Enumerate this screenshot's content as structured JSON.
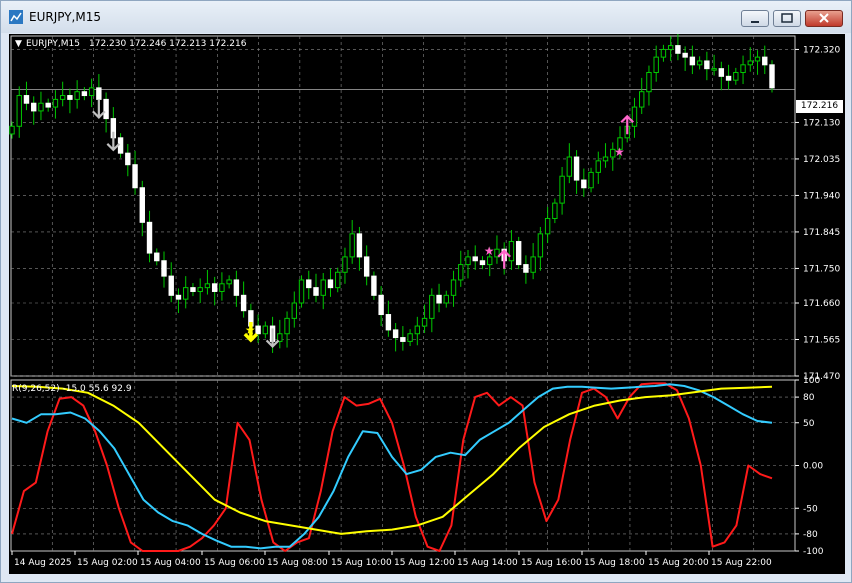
{
  "window": {
    "title": "EURJPY,M15"
  },
  "chart_data": [
    {
      "type": "candlestick",
      "symbol_header": "EURJPY,M15",
      "ohlc_header": "172.230 172.246 172.213 172.216",
      "current_price": "172.216",
      "y_ticks": [
        "172.320",
        "172.216",
        "172.130",
        "172.035",
        "171.940",
        "171.845",
        "171.750",
        "171.660",
        "171.565",
        "171.470"
      ],
      "ylim": [
        171.47,
        172.355
      ],
      "x_ticks": [
        "14 Aug 2025",
        "15 Aug 02:00",
        "15 Aug 04:00",
        "15 Aug 06:00",
        "15 Aug 08:00",
        "15 Aug 10:00",
        "15 Aug 12:00",
        "15 Aug 14:00",
        "15 Aug 16:00",
        "15 Aug 18:00",
        "15 Aug 20:00",
        "15 Aug 22:00"
      ],
      "close": [
        172.12,
        172.2,
        172.18,
        172.16,
        172.18,
        172.17,
        172.19,
        172.2,
        172.19,
        172.21,
        172.2,
        172.22,
        172.19,
        172.14,
        172.09,
        172.05,
        172.02,
        171.96,
        171.87,
        171.79,
        171.77,
        171.73,
        171.68,
        171.67,
        171.7,
        171.69,
        171.7,
        171.71,
        171.69,
        171.71,
        171.72,
        171.68,
        171.64,
        171.6,
        171.58,
        171.6,
        171.56,
        171.58,
        171.62,
        171.66,
        171.72,
        171.7,
        171.68,
        171.72,
        171.7,
        171.74,
        171.78,
        171.84,
        171.78,
        171.73,
        171.68,
        171.63,
        171.59,
        171.57,
        171.56,
        171.58,
        171.6,
        171.62,
        171.68,
        171.66,
        171.68,
        171.72,
        171.76,
        171.78,
        171.77,
        171.76,
        171.78,
        171.8,
        171.77,
        171.82,
        171.76,
        171.74,
        171.78,
        171.84,
        171.88,
        171.92,
        171.99,
        172.04,
        171.98,
        171.96,
        172.0,
        172.03,
        172.04,
        172.06,
        172.09,
        172.12,
        172.17,
        172.21,
        172.26,
        172.3,
        172.32,
        172.33,
        172.31,
        172.3,
        172.28,
        172.29,
        172.27,
        172.27,
        172.25,
        172.24,
        172.26,
        172.28,
        172.29,
        172.3,
        172.28,
        172.22
      ],
      "indicator": {
        "header": "R(9,26,52) -15.0 55.6 92.9",
        "y_ticks": [
          "100",
          "80",
          "50",
          "0.00",
          "-50",
          "-80",
          "-100"
        ],
        "ylim": [
          -100,
          100
        ],
        "series": [
          {
            "color": "#ff1a1a",
            "values": [
              -80,
              -30,
              -20,
              40,
              78,
              80,
              70,
              40,
              0,
              -50,
              -90,
              -100,
              -100,
              -100,
              -100,
              -95,
              -85,
              -70,
              -50,
              50,
              30,
              -40,
              -90,
              -100,
              -90,
              -85,
              -30,
              40,
              80,
              70,
              72,
              78,
              50,
              0,
              -60,
              -95,
              -100,
              -70,
              30,
              80,
              85,
              70,
              80,
              70,
              -20,
              -65,
              -40,
              30,
              85,
              90,
              80,
              55,
              80,
              95,
              96,
              96,
              88,
              55,
              0,
              -95,
              -90,
              -70,
              0,
              -10,
              -15
            ]
          },
          {
            "color": "#33ccff",
            "values": [
              55,
              50,
              60,
              60,
              62,
              55,
              40,
              20,
              -10,
              -40,
              -55,
              -65,
              -70,
              -80,
              -88,
              -95,
              -95,
              -97,
              -95,
              -95,
              -80,
              -60,
              -30,
              10,
              40,
              38,
              10,
              -10,
              -5,
              10,
              15,
              12,
              30,
              40,
              50,
              65,
              80,
              90,
              92,
              92,
              91,
              90,
              91,
              92,
              93,
              95,
              93,
              88,
              80,
              70,
              60,
              52,
              50
            ]
          },
          {
            "color": "#ffff00",
            "values": [
              93,
              92,
              90,
              85,
              70,
              50,
              20,
              -10,
              -40,
              -55,
              -65,
              -70,
              -75,
              -80,
              -77,
              -75,
              -70,
              -60,
              -35,
              -10,
              20,
              45,
              60,
              70,
              76,
              80,
              82,
              86,
              90,
              91,
              92
            ]
          }
        ]
      },
      "markers": [
        {
          "type": "arrow-down",
          "color": "#c0c0c0"
        },
        {
          "type": "arrow-down",
          "color": "#c0c0c0"
        },
        {
          "type": "arrow-down",
          "color": "#ffff00"
        },
        {
          "type": "star",
          "color": "#ffff00"
        },
        {
          "type": "arrow-down",
          "color": "#c0c0c0"
        },
        {
          "type": "star",
          "color": "#ff66cc"
        },
        {
          "type": "arrow-up",
          "color": "#ff66cc"
        },
        {
          "type": "arrow-up",
          "color": "#ff66cc"
        },
        {
          "type": "star",
          "color": "#ff66cc"
        }
      ]
    }
  ]
}
